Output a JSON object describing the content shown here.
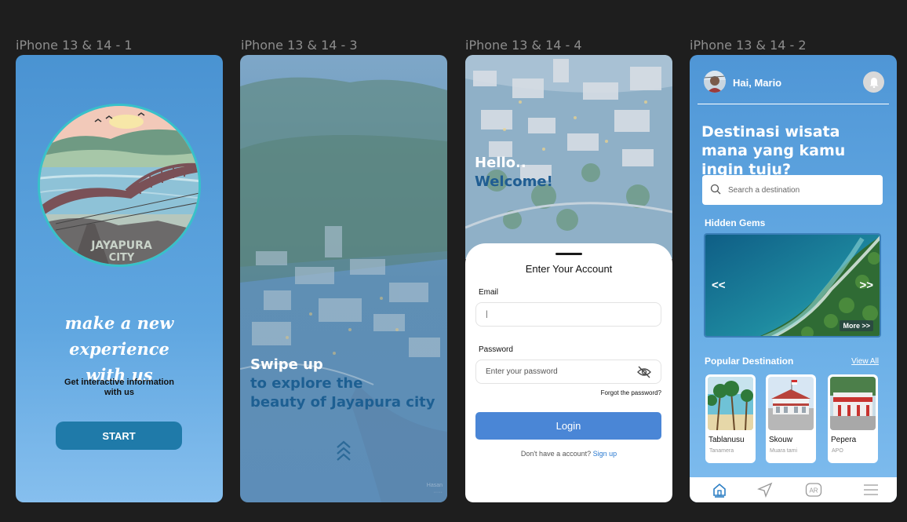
{
  "frames": {
    "f1": "iPhone 13 & 14 - 1",
    "f3": "iPhone 13 & 14 - 3",
    "f4": "iPhone 13 & 14 - 4",
    "f2": "iPhone 13 & 14 - 2"
  },
  "splash": {
    "logo_text_1": "JAYAPURA",
    "logo_text_2": "CITY",
    "title_1": "make a new experience",
    "title_2": "with us",
    "subtitle_1": "Get interactive information",
    "subtitle_2": "with us",
    "start_label": "START"
  },
  "swipe": {
    "line_1": "Swipe up",
    "line_2": "to explore the",
    "line_3": "beauty of Jayapura city",
    "watermark_1": "Hasan",
    "watermark_2": "·····"
  },
  "login": {
    "hello": "Hello..",
    "welcome": "Welcome!",
    "sheet_title": "Enter Your Account",
    "email_label": "Email",
    "email_value": "|",
    "password_label": "Password",
    "password_placeholder": "Enter your password",
    "forgot": "Forgot the password?",
    "login_label": "Login",
    "no_account": "Don't have a account?",
    "signup": "Sign up"
  },
  "home": {
    "greeting": "Hai, Mario",
    "headline": "Destinasi wisata mana yang kamu ingin tuju?",
    "search_placeholder": "Search a destination",
    "hidden_gems": "Hidden Gems",
    "prev": "<<",
    "next": ">>",
    "more": "More >>",
    "popular": "Popular Destination",
    "view_all": "View All",
    "destinations": [
      {
        "name": "Tablanusu",
        "sub": "Tanamera"
      },
      {
        "name": "Skouw",
        "sub": "Muara tami"
      },
      {
        "name": "Pepera",
        "sub": "APO"
      }
    ],
    "tabs": [
      "home-icon",
      "navigate-icon",
      "ar-icon",
      "menu-icon"
    ],
    "ar_label": "AR"
  },
  "colors": {
    "background": "#1e1e1e",
    "primary_blue": "#4a93d2",
    "start_button": "#1f7aa9",
    "login_button": "#4a86d6",
    "accent_dark": "#1f5d92",
    "tab_active": "#2b7ec4"
  }
}
